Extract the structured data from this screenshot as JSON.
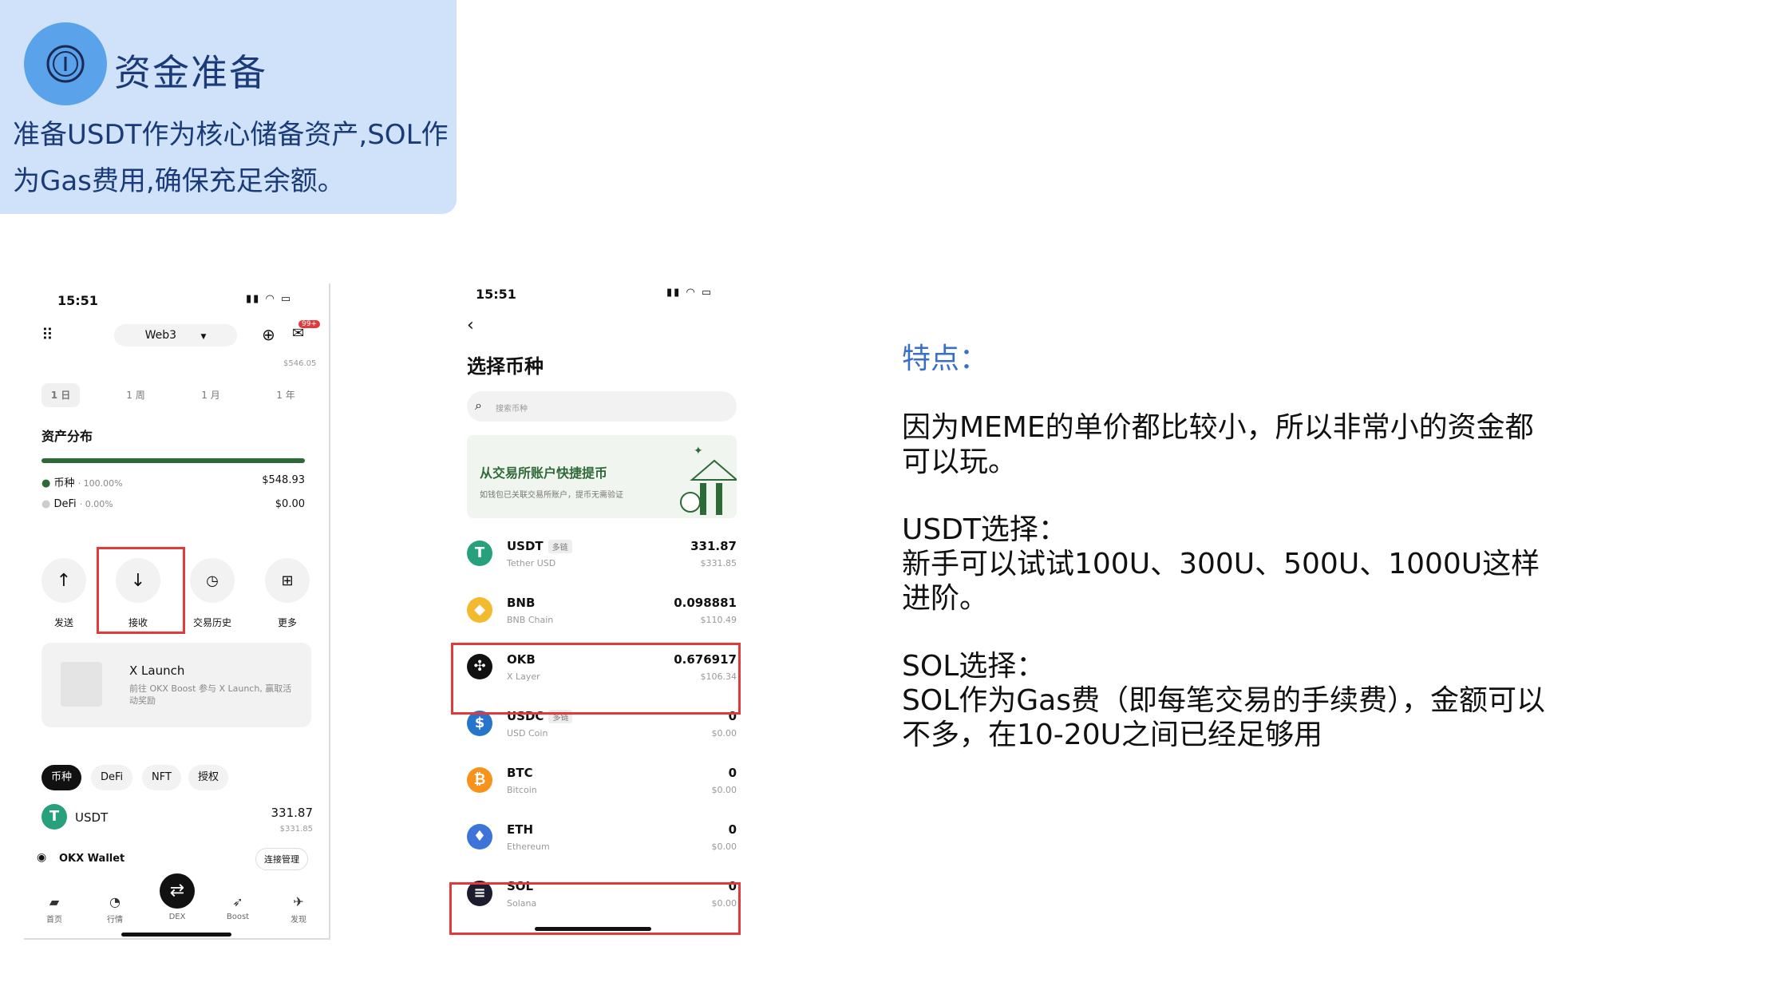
{
  "header": {
    "title": "资金准备",
    "description": "准备USDT作为核心储备资产,SOL作为Gas费用,确保充足余额。"
  },
  "phone1": {
    "time": "15:51",
    "network_selector": "Web3",
    "notification_badge": "99+",
    "balance_small": "$546.05",
    "periods": [
      "1 日",
      "1 周",
      "1 月",
      "1 年"
    ],
    "asset_title": "资产分布",
    "assets": [
      {
        "label": "币种",
        "percent": "100.00%",
        "value": "$548.93"
      },
      {
        "label": "DeFi",
        "percent": "0.00%",
        "value": "$0.00"
      }
    ],
    "actions": [
      {
        "label": "发送",
        "icon": "arrow-up-icon"
      },
      {
        "label": "接收",
        "icon": "arrow-down-icon"
      },
      {
        "label": "交易历史",
        "icon": "history-icon"
      },
      {
        "label": "更多",
        "icon": "grid-icon"
      }
    ],
    "launch": {
      "title": "X Launch",
      "desc": "前往 OKX Boost 参与 X Launch, 赢取活动奖励"
    },
    "chips": [
      "币种",
      "DeFi",
      "NFT",
      "授权"
    ],
    "holding": {
      "name": "USDT",
      "amount": "331.87",
      "value": "$331.85"
    },
    "wallet_name": "OKX Wallet",
    "manage_button": "连接管理",
    "nav": [
      "首页",
      "行情",
      "DEX",
      "Boost",
      "发现"
    ]
  },
  "phone2": {
    "time": "15:51",
    "title": "选择币种",
    "search_placeholder": "搜索币种",
    "promo_title": "从交易所账户快捷提币",
    "promo_desc": "如钱包已关联交易所账户，提币无需验证",
    "multi_chain_tag": "多链",
    "coins": [
      {
        "name": "USDT",
        "sub": "Tether USD",
        "amount": "331.87",
        "value": "$331.85",
        "color": "#26a17b",
        "glyph": "T"
      },
      {
        "name": "BNB",
        "sub": "BNB Chain",
        "amount": "0.098881",
        "value": "$110.49",
        "color": "#f3ba2f",
        "glyph": "◆"
      },
      {
        "name": "OKB",
        "sub": "X Layer",
        "amount": "0.676917",
        "value": "$106.34",
        "color": "#111111",
        "glyph": "✣"
      },
      {
        "name": "USDC",
        "sub": "USD Coin",
        "amount": "0",
        "value": "$0.00",
        "color": "#2775ca",
        "glyph": "$"
      },
      {
        "name": "BTC",
        "sub": "Bitcoin",
        "amount": "0",
        "value": "$0.00",
        "color": "#f7931a",
        "glyph": "₿"
      },
      {
        "name": "ETH",
        "sub": "Ethereum",
        "amount": "0",
        "value": "$0.00",
        "color": "#3e73d8",
        "glyph": "♦"
      },
      {
        "name": "SOL",
        "sub": "Solana",
        "amount": "0",
        "value": "$0.00",
        "color": "#1c1c2e",
        "glyph": "≡"
      }
    ]
  },
  "features": {
    "title": "特点：",
    "p1": "因为MEME的单价都比较小，所以非常小的资金都可以玩。",
    "p2_title": "USDT选择：",
    "p2": "新手可以试试100U、300U、500U、1000U这样进阶。",
    "p3_title": "SOL选择：",
    "p3": "SOL作为Gas费（即每笔交易的手续费），金额可以不多，在10-20U之间已经足够用"
  },
  "colors": {
    "header_bg": "#cfe2f9",
    "header_text": "#1a3b78",
    "badge": "#5aa2ea",
    "highlight_red": "#e03a3a",
    "feature_title": "#3a6fc8",
    "asset_bar": "#2e6a38"
  }
}
